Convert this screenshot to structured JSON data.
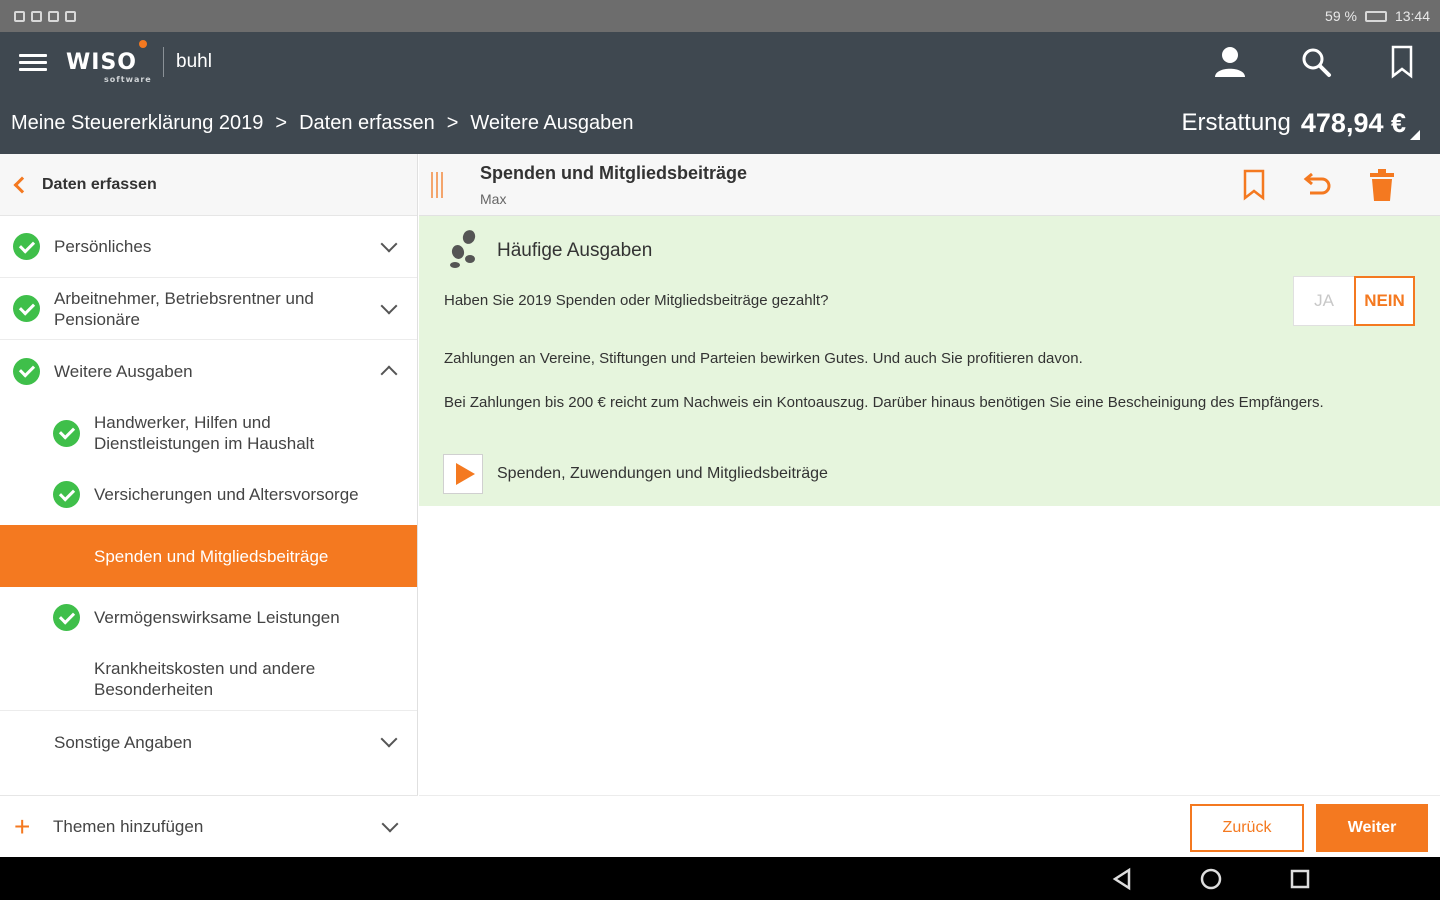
{
  "statusbar": {
    "right": "59 %",
    "time": "13:44"
  },
  "app": {
    "logo_text": "WISO",
    "logo_sub": "software",
    "logo_brand": "buhl"
  },
  "breadcrumb": {
    "items": [
      "Meine Steuererklärung 2019",
      "Daten erfassen",
      "Weitere Ausgaben"
    ],
    "separator": ">"
  },
  "refund": {
    "label": "Erstattung",
    "amount": "478,94 €"
  },
  "sidebar": {
    "back_label": "Daten erfassen",
    "items": [
      {
        "label": "Persönliches"
      },
      {
        "label": "Arbeitnehmer, Betriebsrentner und Pensionäre"
      },
      {
        "label": "Weitere Ausgaben"
      },
      {
        "label": "Handwerker, Hilfen und Dienstleistungen im Haushalt"
      },
      {
        "label": "Versicherungen und Altersvorsorge"
      },
      {
        "label": "Spenden und Mitgliedsbeiträge"
      },
      {
        "label": "Vermögenswirksame Leistungen"
      },
      {
        "label": "Krankheitskosten und andere Besonderheiten"
      },
      {
        "label": "Sonstige Angaben"
      }
    ],
    "add_label": "Themen hinzufügen"
  },
  "content": {
    "title": "Spenden und Mitgliedsbeiträge",
    "subtitle": "Max",
    "panel_title": "Häufige Ausgaben",
    "question": "Haben Sie 2019 Spenden oder Mitgliedsbeiträge gezahlt?",
    "yes_label": "JA",
    "no_label": "NEIN",
    "para1": "Zahlungen an Vereine, Stiftungen und Parteien bewirken Gutes. Und auch Sie profitieren davon.",
    "para2": "Bei Zahlungen bis 200 € reicht zum Nachweis ein Kontoauszug. Darüber hinaus benötigen Sie eine Bescheinigung des Empfängers.",
    "video_label": "Spenden, Zuwendungen und Mitgliedsbeiträge"
  },
  "footer": {
    "back_label": "Zurück",
    "next_label": "Weiter"
  },
  "colors": {
    "accent": "#f47920",
    "header": "#3f4850",
    "panel": "#e6f5dd",
    "check": "#3fbf4a"
  }
}
